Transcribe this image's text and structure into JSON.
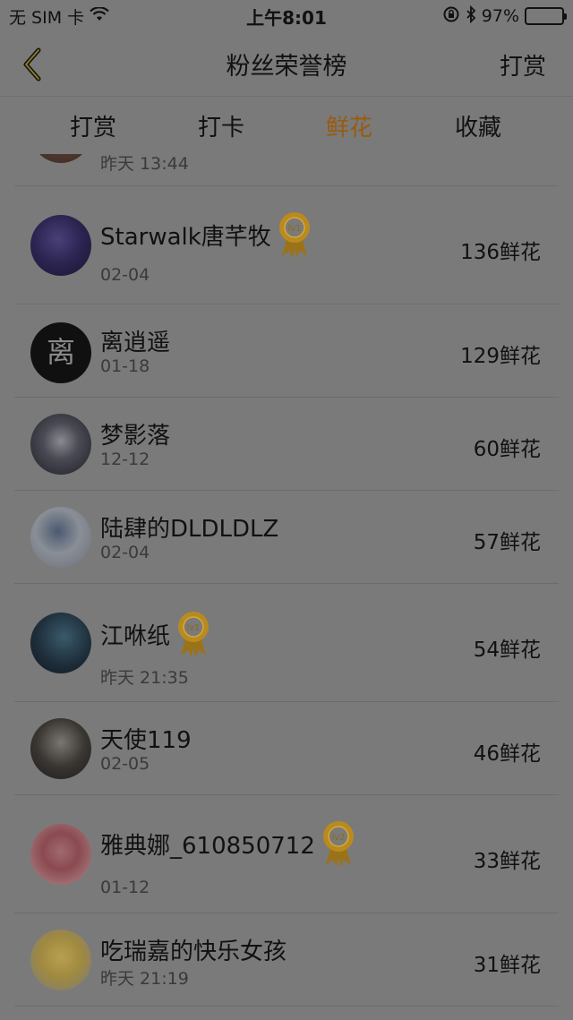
{
  "status_bar": {
    "carrier": "无 SIM 卡",
    "time": "上午8:01",
    "battery": "97%",
    "icons": [
      "wifi-icon",
      "rotation-lock-icon",
      "bluetooth-icon",
      "battery-icon"
    ]
  },
  "nav": {
    "title": "粉丝荣誉榜",
    "right_button": "打赏",
    "back_icon": "chevron-left-icon"
  },
  "tabs": [
    {
      "label": "打赏",
      "active": false
    },
    {
      "label": "打卡",
      "active": false
    },
    {
      "label": "鲜花",
      "active": true
    },
    {
      "label": "收藏",
      "active": false
    }
  ],
  "partial_row": {
    "date": "昨天 13:44"
  },
  "fans": [
    {
      "name": "Starwalk唐芊牧",
      "date": "02-04",
      "count": "136鲜花",
      "badge": "lv1"
    },
    {
      "name": "离逍遥",
      "date": "01-18",
      "count": "129鲜花",
      "badge": null
    },
    {
      "name": "梦影落",
      "date": "12-12",
      "count": "60鲜花",
      "badge": null
    },
    {
      "name": "陆肆的DLDLDLZ",
      "date": "02-04",
      "count": "57鲜花",
      "badge": null
    },
    {
      "name": "江咻纸",
      "date": "昨天 21:35",
      "count": "54鲜花",
      "badge": "lv1"
    },
    {
      "name": "天使119",
      "date": "02-05",
      "count": "46鲜花",
      "badge": null
    },
    {
      "name": "雅典娜_610850712",
      "date": "01-12",
      "count": "33鲜花",
      "badge": "lv2"
    },
    {
      "name": "吃瑞嘉的快乐女孩",
      "date": "昨天 21:19",
      "count": "31鲜花",
      "badge": null
    }
  ],
  "colors": {
    "overlay_bg": "#7a7a7a",
    "active_tab": "#9a5a10",
    "medal_gold": "#b98a1e"
  }
}
